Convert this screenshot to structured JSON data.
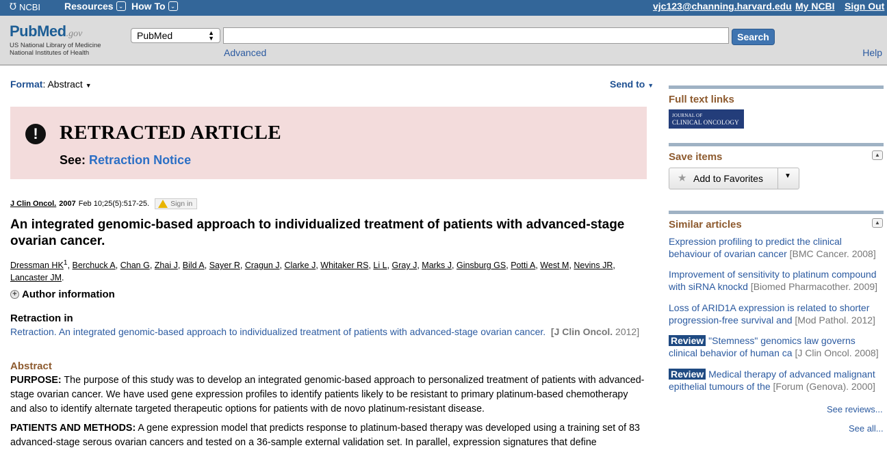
{
  "topbar": {
    "ncbi": "NCBI",
    "resources": "Resources",
    "howto": "How To",
    "user": "vjc123@channing.harvard.edu",
    "myncbi": "My NCBI",
    "signout": "Sign Out"
  },
  "logo": {
    "pub": "Pub",
    "med": "Med",
    "gov": ".gov",
    "line1": "US National Library of Medicine",
    "line2": "National Institutes of Health"
  },
  "search": {
    "db": "PubMed",
    "query": "",
    "button": "Search",
    "advanced": "Advanced",
    "help": "Help"
  },
  "format": {
    "label": "Format",
    "value": "Abstract"
  },
  "sendto": "Send to",
  "retracted": {
    "title": "RETRACTED ARTICLE",
    "see": "See:",
    "link": "Retraction Notice"
  },
  "citation": {
    "journal": "J Clin Oncol.",
    "year": "2007",
    "rest": "Feb 10;25(5):517-25.",
    "signin": "Sign in"
  },
  "article_title": "An integrated genomic-based approach to individualized treatment of patients with advanced-stage ovarian cancer.",
  "authors": [
    "Dressman HK",
    "Berchuck A",
    "Chan G",
    "Zhai J",
    "Bild A",
    "Sayer R",
    "Cragun J",
    "Clarke J",
    "Whitaker RS",
    "Li L",
    "Gray J",
    "Marks J",
    "Ginsburg GS",
    "Potti A",
    "West M",
    "Nevins JR",
    "Lancaster JM"
  ],
  "author_sup": "1",
  "author_info": "Author information",
  "retraction_in": {
    "heading": "Retraction in",
    "text": "Retraction. An integrated genomic-based approach to individualized treatment of patients with advanced-stage ovarian cancer.",
    "journal": "[J Clin Oncol.",
    "year": "2012]"
  },
  "abstract": {
    "heading": "Abstract",
    "purpose_label": "PURPOSE:",
    "purpose": "The purpose of this study was to develop an integrated genomic-based approach to personalized treatment of patients with advanced-stage ovarian cancer. We have used gene expression profiles to identify patients likely to be resistant to primary platinum-based chemotherapy and also to identify alternate targeted therapeutic options for patients with de novo platinum-resistant disease.",
    "methods_label": "PATIENTS AND METHODS:",
    "methods": "A gene expression model that predicts response to platinum-based therapy was developed using a training set of 83 advanced-stage serous ovarian cancers and tested on a 36-sample external validation set. In parallel, expression signatures that define"
  },
  "sidebar": {
    "fulltext_heading": "Full text links",
    "jco_line1": "Journal of",
    "jco_line2": "Clinical Oncology",
    "save_heading": "Save items",
    "add_favorites": "Add to Favorites",
    "similar_heading": "Similar articles",
    "similar": [
      {
        "badge": "",
        "title": "Expression profiling to predict the clinical behaviour of ovarian cancer",
        "source": "[BMC Cancer. 2008]"
      },
      {
        "badge": "",
        "title": "Improvement of sensitivity to platinum compound with siRNA knockd",
        "source": "[Biomed Pharmacother. 2009]"
      },
      {
        "badge": "",
        "title": "Loss of ARID1A expression is related to shorter progression-free survival and",
        "source": "[Mod Pathol. 2012]"
      },
      {
        "badge": "Review",
        "title": "\"Stemness\" genomics law governs clinical behavior of human ca",
        "source": "[J Clin Oncol. 2008]"
      },
      {
        "badge": "Review",
        "title": "Medical therapy of advanced malignant epithelial tumours of the",
        "source": "[Forum (Genova). 2000]"
      }
    ],
    "see_reviews": "See reviews...",
    "see_all": "See all..."
  }
}
